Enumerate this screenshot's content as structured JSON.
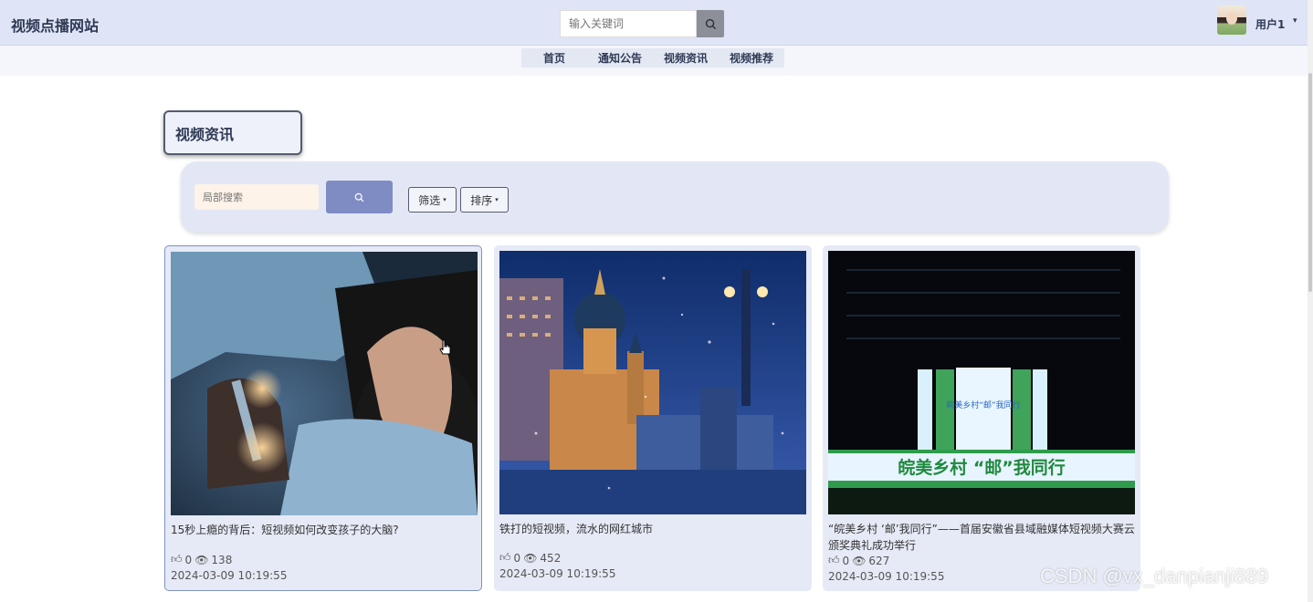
{
  "header": {
    "site_title": "视频点播网站",
    "search_placeholder": "输入关键词",
    "username": "用户1",
    "caret": "▾"
  },
  "nav": {
    "items": [
      {
        "label": "首页"
      },
      {
        "label": "通知公告"
      },
      {
        "label": "视频资讯"
      },
      {
        "label": "视频推荐"
      }
    ]
  },
  "section": {
    "title": "视频资讯"
  },
  "filter": {
    "search_placeholder": "局部搜索",
    "filter_label": "筛选",
    "sort_label": "排序",
    "caret": "▾"
  },
  "cards": [
    {
      "title": "15秒上瘾的背后：短视频如何改变孩子的大脑?",
      "likes": "0",
      "views": "138",
      "date": "2024-03-09 10:19:55"
    },
    {
      "title": "铁打的短视频，流水的网红城市",
      "likes": "0",
      "views": "452",
      "date": "2024-03-09 10:19:55"
    },
    {
      "title": "“皖美乡村 ‘邮’我同行”——首届安徽省县域融媒体短视频大赛云颁奖典礼成功举行",
      "likes": "0",
      "views": "627",
      "date": "2024-03-09 10:19:55"
    }
  ],
  "images": {
    "stage_banner_text": "皖美乡村 “邮”我同行",
    "stage_screen_text": "皖美乡村“邮”我同行"
  },
  "watermark": "CSDN @vx_danpianji889",
  "colors": {
    "header_bg": "#dfe5f6",
    "accent_button": "#7f8cc4",
    "card_bg": "#e6eaf6"
  }
}
